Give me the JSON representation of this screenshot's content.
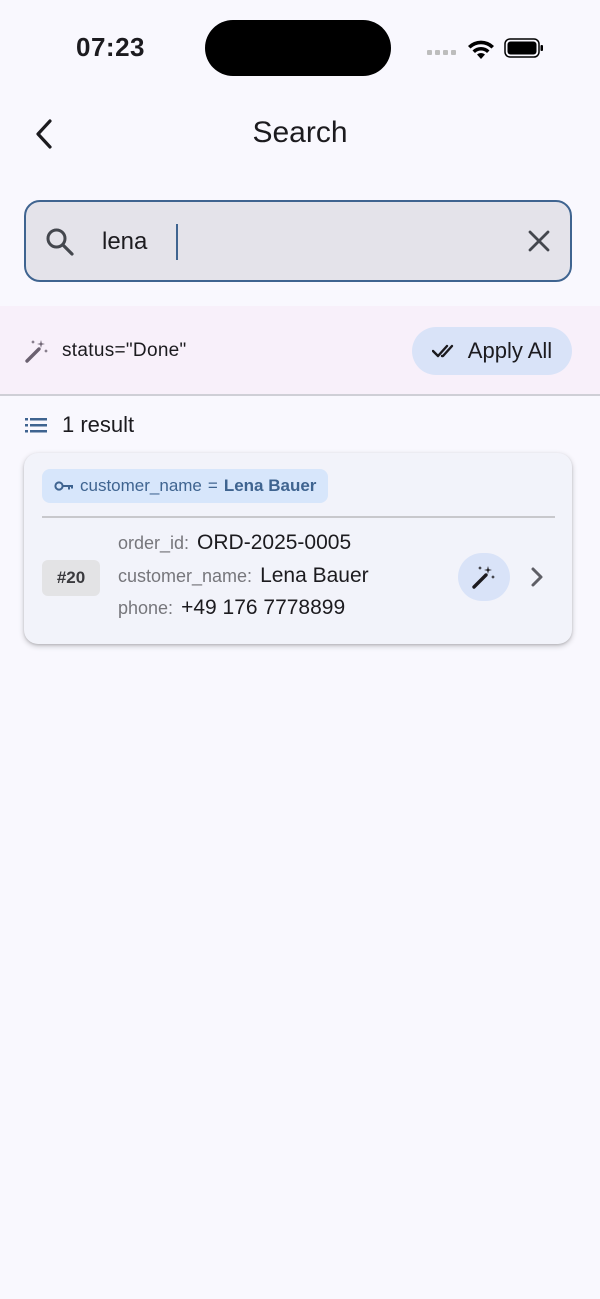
{
  "status_bar": {
    "time": "07:23"
  },
  "app_bar": {
    "title": "Search"
  },
  "search": {
    "query": "lena",
    "placeholder": ""
  },
  "filter": {
    "expression": "status=\"Done\"",
    "apply_all_label": "Apply All"
  },
  "results": {
    "count_label": "1 result",
    "items": [
      {
        "match_key": "customer_name",
        "match_op": "=",
        "match_value": "Lena Bauer",
        "row_badge": "#20",
        "fields": [
          {
            "key": "order_id:",
            "value": "ORD-2025-0005"
          },
          {
            "key": "customer_name:",
            "value": "Lena Bauer"
          },
          {
            "key": "phone:",
            "value": "+49 176 7778899"
          }
        ]
      }
    ]
  },
  "colors": {
    "accent": "#3f6490",
    "chip_bg": "#d7e6fb",
    "tonal_button": "#d9e3f8",
    "background": "#f9f8fe"
  },
  "icons": [
    "back-arrow-icon",
    "search-icon",
    "clear-icon",
    "magic-wand-icon",
    "double-check-icon",
    "list-icon",
    "key-icon",
    "chevron-right-icon"
  ]
}
